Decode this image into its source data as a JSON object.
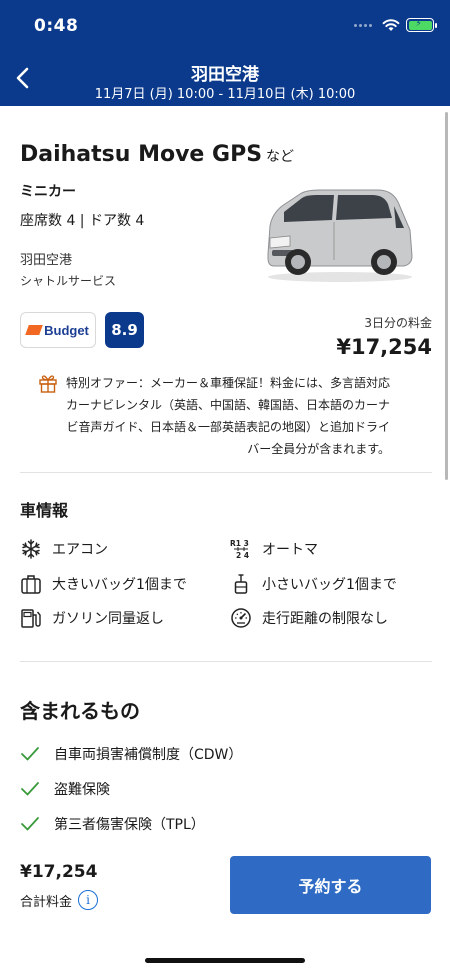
{
  "status_bar": {
    "time": "0:48"
  },
  "header": {
    "title": "羽田空港",
    "subtitle": "11月7日 (月) 10:00 - 11月10日 (木) 10:00"
  },
  "car": {
    "name": "Daihatsu Move GPS",
    "name_suffix": "など",
    "class": "ミニカー",
    "spec": "座席数 4 | ドア数 4",
    "pickup_location": "羽田空港",
    "pickup_type": "シャトルサービス"
  },
  "vendor": {
    "name": "Budget",
    "rating": "8.9"
  },
  "price": {
    "label": "3日分の料金",
    "value": "¥17,254"
  },
  "offer": {
    "lines": [
      "特別オファー：メーカー＆車種保証！料金には、多言語対応",
      "カーナビレンタル（英語、中国語、韓国語、日本語のカーナ",
      "ビ音声ガイド、日本語＆一部英語表記の地図）と追加ドライ",
      "バー全員分が含まれます。"
    ]
  },
  "car_info": {
    "title": "車情報",
    "features": [
      {
        "label": "エアコン",
        "icon": "snowflake-icon"
      },
      {
        "label": "オートマ",
        "icon": "gearshift-icon"
      },
      {
        "label": "大きいバッグ1個まで",
        "icon": "suitcase-icon"
      },
      {
        "label": "小さいバッグ1個まで",
        "icon": "small-bag-icon"
      },
      {
        "label": "ガソリン同量返し",
        "icon": "fuel-pump-icon"
      },
      {
        "label": "走行距離の制限なし",
        "icon": "speedometer-icon"
      }
    ]
  },
  "included": {
    "title": "含まれるもの",
    "items": [
      "自車両損害補償制度（CDW）",
      "盗難保険",
      "第三者傷害保険（TPL）"
    ]
  },
  "footer": {
    "total_price": "¥17,254",
    "total_label": "合計料金",
    "book_button": "予約する"
  },
  "colors": {
    "header_bg": "#0b3a8c",
    "button_bg": "#2f6bc4",
    "check_green": "#3a9a3a",
    "offer_orange": "#c8600f"
  }
}
